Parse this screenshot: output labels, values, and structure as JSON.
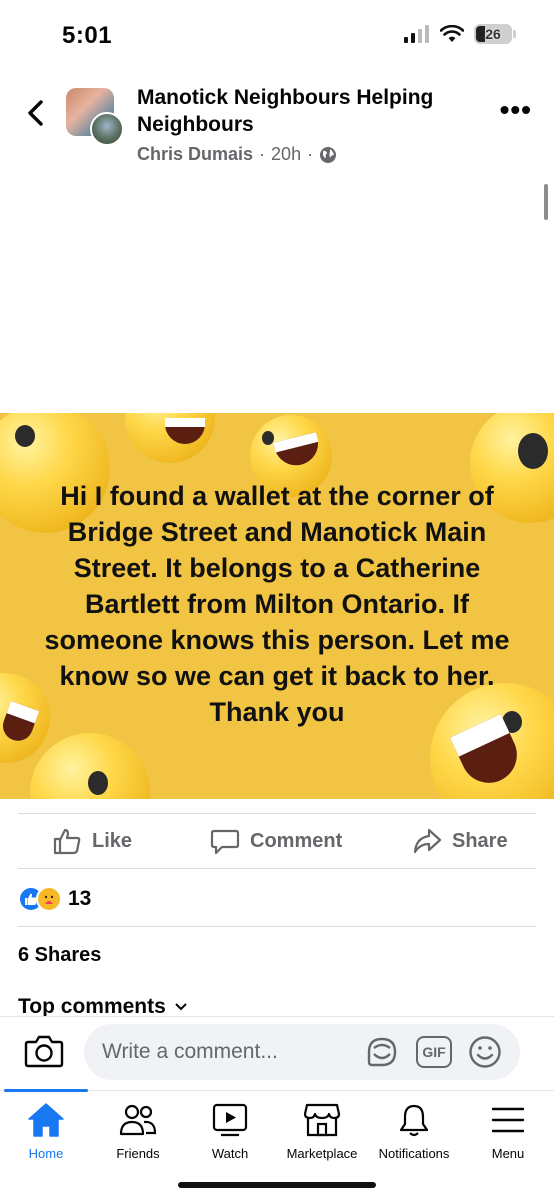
{
  "status_bar": {
    "time": "5:01",
    "battery": "26"
  },
  "header": {
    "group_name": "Manotick Neighbours Helping Neighbours",
    "author": "Chris Dumais",
    "time": "20h",
    "separator": "·",
    "privacy_icon": "globe-icon"
  },
  "post": {
    "text": "Hi I found a wallet at the corner of Bridge Street and Manotick Main Street. It belongs to a Catherine Bartlett from Milton Ontario. If someone knows this person. Let me know so we can get it back to her. Thank you",
    "background_color": "#f1c443"
  },
  "actions": {
    "like": "Like",
    "comment": "Comment",
    "share": "Share"
  },
  "reactions": {
    "count": "13",
    "types": [
      "like",
      "care"
    ]
  },
  "shares_text": "6 Shares",
  "comments_header": "Top comments",
  "composer": {
    "placeholder": "Write a comment...",
    "gif_label": "GIF"
  },
  "tabs": [
    {
      "label": "Home",
      "icon": "home-icon",
      "active": true
    },
    {
      "label": "Friends",
      "icon": "friends-icon"
    },
    {
      "label": "Watch",
      "icon": "watch-icon"
    },
    {
      "label": "Marketplace",
      "icon": "marketplace-icon"
    },
    {
      "label": "Notifications",
      "icon": "bell-icon"
    },
    {
      "label": "Menu",
      "icon": "menu-icon"
    }
  ],
  "colors": {
    "accent": "#1877f2",
    "secondary_text": "#65676b"
  }
}
